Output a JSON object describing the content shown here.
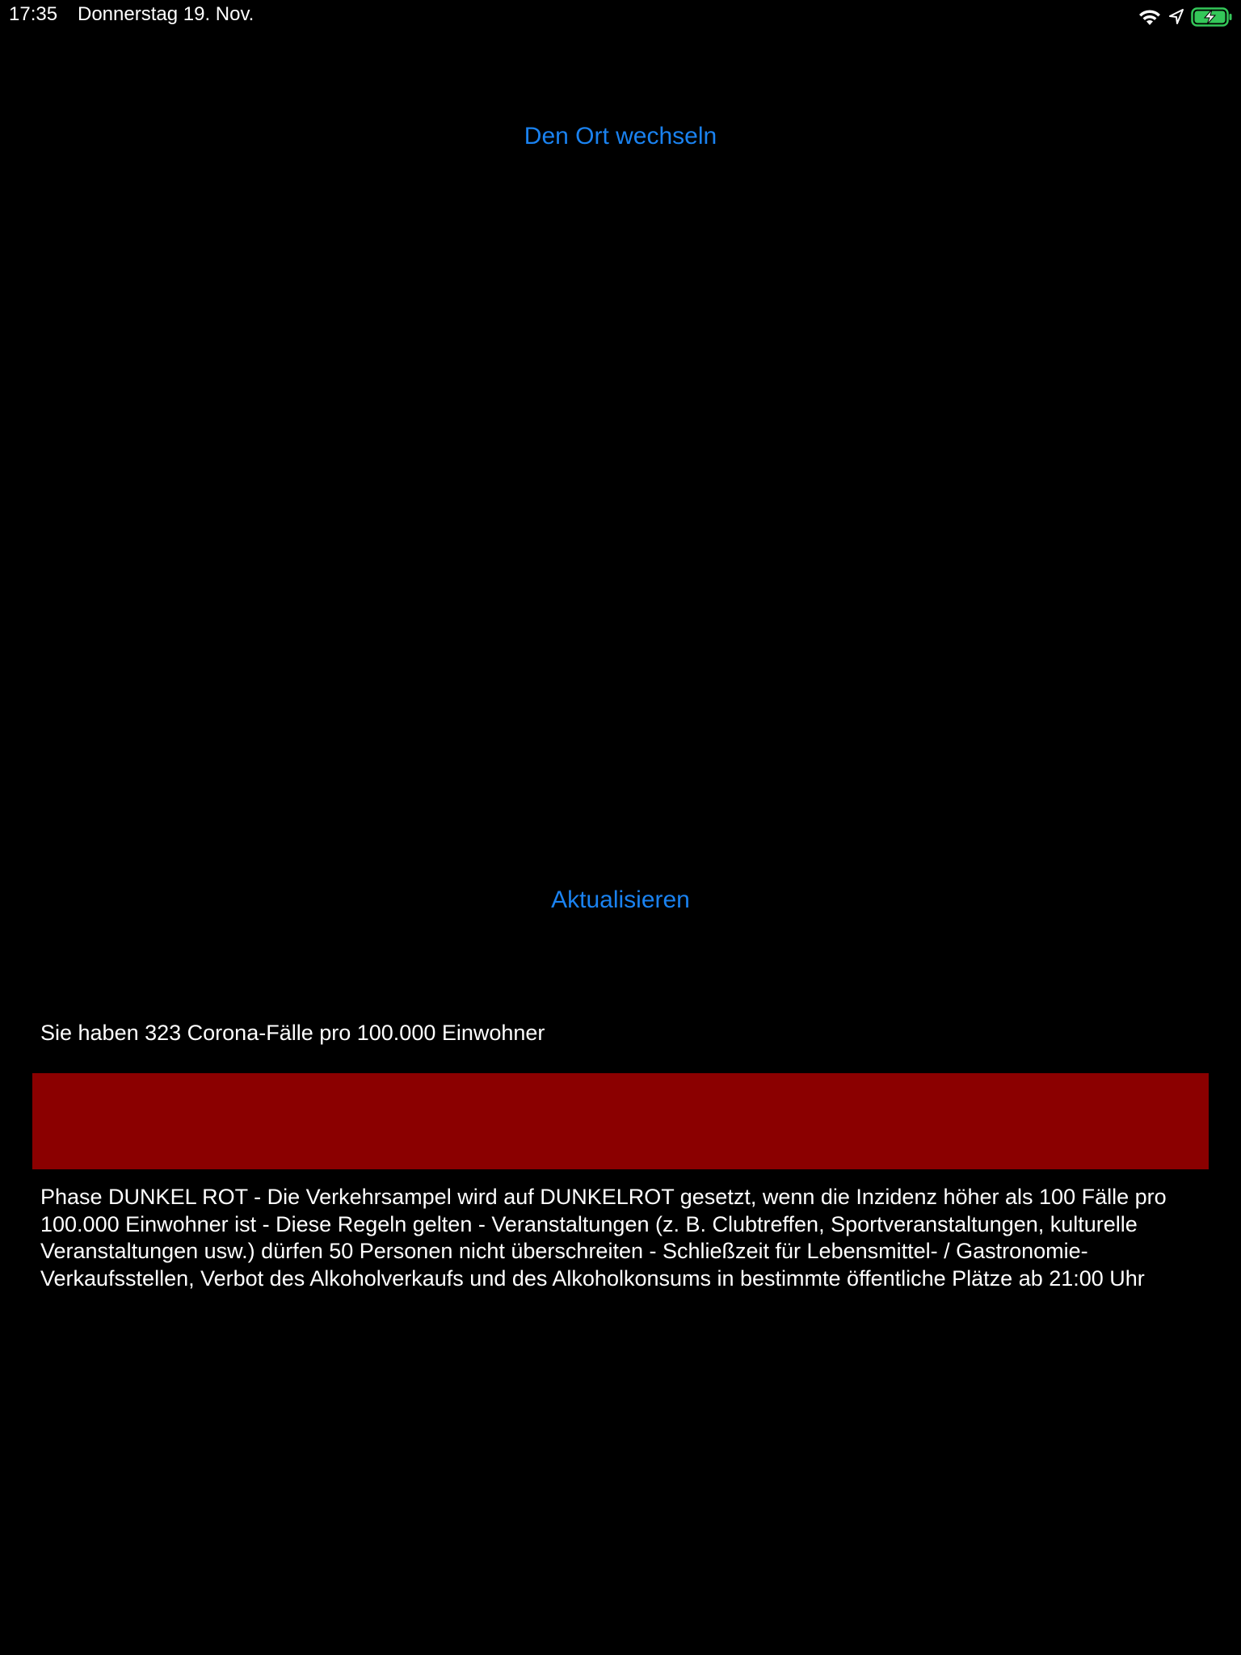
{
  "status_bar": {
    "time": "17:35",
    "date": "Donnerstag 19. Nov.",
    "icons": [
      "wifi-icon",
      "location-arrow-icon",
      "battery-charging-icon"
    ],
    "battery_color": "#34c759"
  },
  "main": {
    "change_location_label": "Den Ort wechseln",
    "refresh_label": "Aktualisieren",
    "incidence_text": "Sie haben 323 Corona-Fälle pro 100.000 Einwohner",
    "phase_color": "#8b0000",
    "phase_description": "Phase DUNKEL ROT - Die Verkehrsampel wird auf DUNKELROT gesetzt, wenn die Inzidenz höher als 100 Fälle pro 100.000 Einwohner ist - Diese Regeln gelten - Veranstaltungen (z. B. Clubtreffen, Sportveranstaltungen, kulturelle Veranstaltungen usw.) dürfen 50 Personen nicht überschreiten - Schließzeit für Lebensmittel- / Gastronomie-Verkaufsstellen, Verbot des Alkoholverkaufs und des Alkoholkonsums in bestimmte öffentliche Plätze ab 21:00 Uhr"
  },
  "colors": {
    "background": "#000000",
    "accent": "#1a82f0",
    "text": "#ffffff"
  }
}
